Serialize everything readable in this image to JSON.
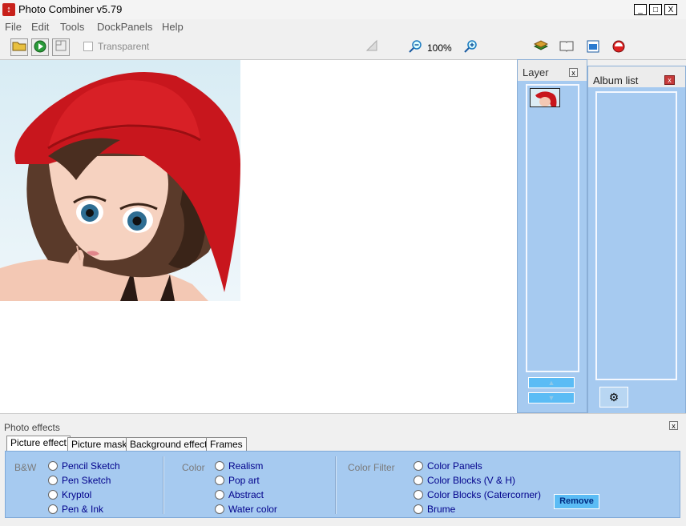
{
  "window": {
    "title": "Photo Combiner v5.79",
    "minimize": "_",
    "maximize": "□",
    "close": "X"
  },
  "menu": [
    "File",
    "Edit",
    "Tools",
    "DockPanels",
    "Help"
  ],
  "toolbar": {
    "transparent_label": "Transparent",
    "zoom_level": "100%"
  },
  "layer_panel": {
    "title": "Layer",
    "close": "x"
  },
  "album_panel": {
    "title": "Album list",
    "close": "x"
  },
  "effects": {
    "title": "Photo effects",
    "close": "x",
    "tabs": [
      "Picture effect",
      "Picture mask",
      "Background effect",
      "Frames"
    ],
    "active_tab": "Picture effect",
    "groups": [
      {
        "label": "B&W",
        "options": [
          "Pencil Sketch",
          "Pen Sketch",
          "Kryptol",
          "Pen & Ink"
        ]
      },
      {
        "label": "Color",
        "options": [
          "Realism",
          "Pop art",
          "Abstract",
          "Water color"
        ]
      },
      {
        "label": "Color Filter",
        "options": [
          "Color Panels",
          "Color Blocks (V & H)",
          "Color Blocks (Catercorner)",
          "Brume"
        ]
      }
    ],
    "remove_label": "Remove"
  },
  "colors": {
    "panel_blue": "#a6caf0",
    "accent_blue": "#5bbcf5",
    "hat_red": "#c8161d"
  }
}
